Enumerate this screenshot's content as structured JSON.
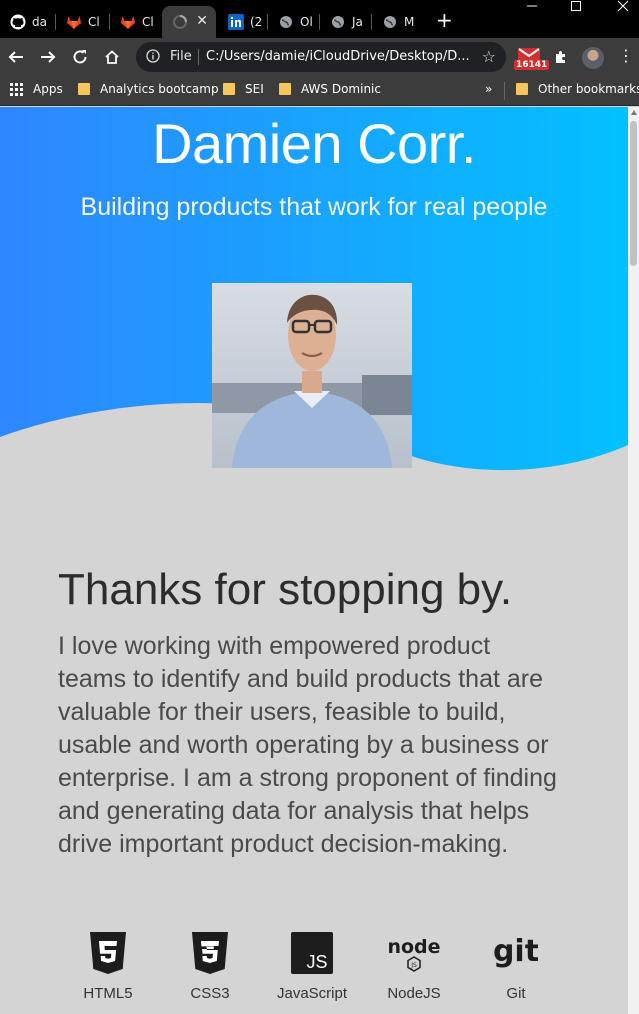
{
  "browser": {
    "tabs": [
      {
        "label": "da",
        "icon": "github-icon"
      },
      {
        "label": "Cl",
        "icon": "gitlab-icon"
      },
      {
        "label": "Cl",
        "icon": "gitlab-icon"
      },
      {
        "label": "",
        "icon": "loading-icon",
        "active": true
      },
      {
        "label": "(2",
        "icon": "linkedin-icon"
      },
      {
        "label": "Ol",
        "icon": "globe-icon"
      },
      {
        "label": "Ja",
        "icon": "globe-icon"
      },
      {
        "label": "M",
        "icon": "globe-icon"
      }
    ],
    "close_glyph": "✕",
    "new_tab_glyph": "+",
    "address": {
      "scheme_label": "File",
      "url": "C:/Users/damie/iCloudDrive/Desktop/D..."
    },
    "gmail_badge": "16141",
    "bookmarks": {
      "apps": "Apps",
      "items": [
        "Analytics bootcamp",
        "SEI",
        "AWS Dominic"
      ],
      "overflow": "»",
      "other": "Other bookmarks"
    }
  },
  "hero": {
    "name": "Damien Corr.",
    "tagline": "Building products that work for real people",
    "gradient_start": "#2f86ff",
    "gradient_end": "#02c1ff"
  },
  "about": {
    "heading": "Thanks for stopping by.",
    "body": "I love working with empowered product teams to identify and build products that are valuable for their users, feasible to build, usable and worth operating by a business or enterprise. I am a strong proponent of finding and generating data for analysis that helps drive important product decision-making."
  },
  "skills": [
    {
      "label": "HTML5",
      "icon": "html5-icon"
    },
    {
      "label": "CSS3",
      "icon": "css3-icon"
    },
    {
      "label": "JavaScript",
      "icon": "javascript-icon"
    },
    {
      "label": "NodeJS",
      "icon": "nodejs-icon"
    },
    {
      "label": "Git",
      "icon": "git-icon"
    }
  ]
}
